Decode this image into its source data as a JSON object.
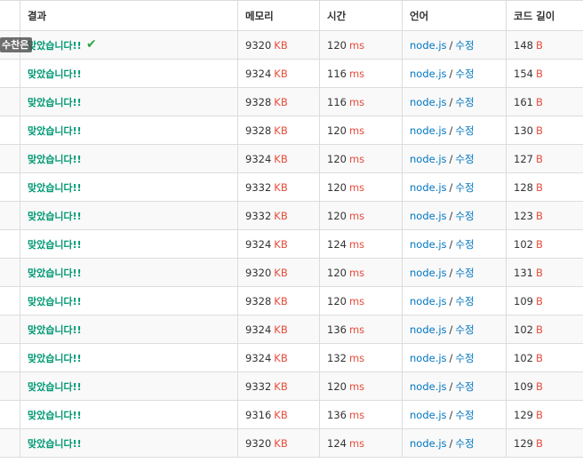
{
  "headers": {
    "result": "결과",
    "memory": "메모리",
    "time": "시간",
    "language": "언어",
    "code_length": "코드 길이"
  },
  "tooltip": "수찬은",
  "icons": {
    "check": "check-icon"
  },
  "units": {
    "memory": "KB",
    "time": "ms",
    "length": "B"
  },
  "edit_label": "수정",
  "rows": [
    {
      "result": "맞았습니다!!",
      "memory": "9320",
      "time": "120",
      "lang": "node.js",
      "length": "148"
    },
    {
      "result": "맞았습니다!!",
      "memory": "9324",
      "time": "116",
      "lang": "node.js",
      "length": "154"
    },
    {
      "result": "맞았습니다!!",
      "memory": "9328",
      "time": "116",
      "lang": "node.js",
      "length": "161"
    },
    {
      "result": "맞았습니다!!",
      "memory": "9328",
      "time": "120",
      "lang": "node.js",
      "length": "130"
    },
    {
      "result": "맞았습니다!!",
      "memory": "9324",
      "time": "120",
      "lang": "node.js",
      "length": "127"
    },
    {
      "result": "맞았습니다!!",
      "memory": "9332",
      "time": "120",
      "lang": "node.js",
      "length": "128"
    },
    {
      "result": "맞았습니다!!",
      "memory": "9332",
      "time": "120",
      "lang": "node.js",
      "length": "123"
    },
    {
      "result": "맞았습니다!!",
      "memory": "9324",
      "time": "124",
      "lang": "node.js",
      "length": "102"
    },
    {
      "result": "맞았습니다!!",
      "memory": "9320",
      "time": "120",
      "lang": "node.js",
      "length": "131"
    },
    {
      "result": "맞았습니다!!",
      "memory": "9328",
      "time": "120",
      "lang": "node.js",
      "length": "109"
    },
    {
      "result": "맞았습니다!!",
      "memory": "9324",
      "time": "136",
      "lang": "node.js",
      "length": "102"
    },
    {
      "result": "맞았습니다!!",
      "memory": "9324",
      "time": "132",
      "lang": "node.js",
      "length": "102"
    },
    {
      "result": "맞았습니다!!",
      "memory": "9332",
      "time": "120",
      "lang": "node.js",
      "length": "109"
    },
    {
      "result": "맞았습니다!!",
      "memory": "9316",
      "time": "136",
      "lang": "node.js",
      "length": "129"
    },
    {
      "result": "맞았습니다!!",
      "memory": "9320",
      "time": "124",
      "lang": "node.js",
      "length": "129"
    }
  ]
}
